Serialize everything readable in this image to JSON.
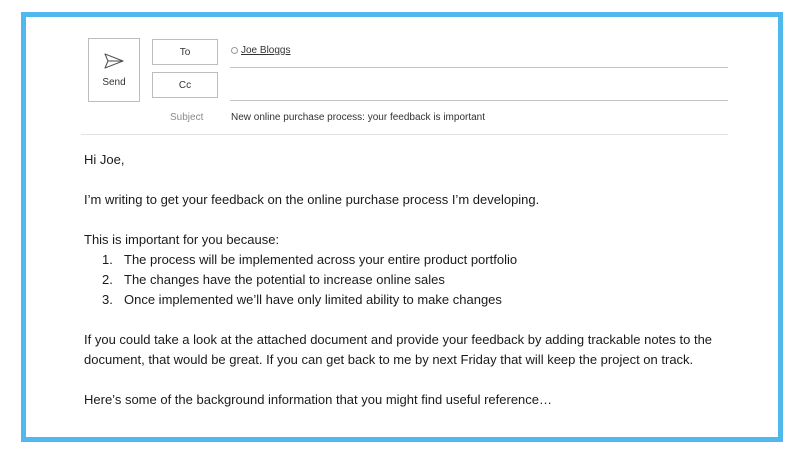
{
  "compose": {
    "send_label": "Send",
    "to_label": "To",
    "cc_label": "Cc",
    "to_recipient": "Joe Bloggs",
    "cc_value": "",
    "subject_label": "Subject",
    "subject_value": "New online purchase process: your feedback is important"
  },
  "body": {
    "greeting": "Hi Joe,",
    "intro": "I’m writing to get your feedback on the online purchase process I’m developing.",
    "important_lead": "This is important for you because:",
    "reasons": [
      {
        "num": "1.",
        "text": "The process will be implemented across your entire product portfolio"
      },
      {
        "num": "2.",
        "text": "The changes have the potential to increase online sales"
      },
      {
        "num": "3.",
        "text": "Once implemented we’ll have only limited ability to make changes"
      }
    ],
    "request": "If you could take a look at the attached document and provide your feedback by adding trackable notes to the document, that would be great. If you can get back to me by next Friday that will keep the project on track.",
    "background": "Here’s some of the background information that you might find useful reference…"
  },
  "colors": {
    "frame_border": "#4fb8ec"
  },
  "icons": {
    "send": "send-icon",
    "recipient_status": "radio-icon"
  }
}
